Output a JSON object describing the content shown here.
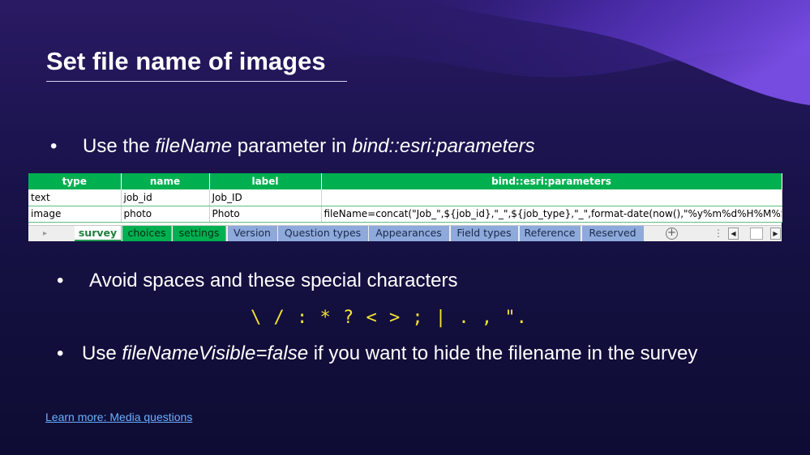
{
  "slide": {
    "title": "Set file name of images",
    "bullet_glyph": "•",
    "bullet1": {
      "pre": "Use the ",
      "em1": "fileName",
      "mid": " parameter in ",
      "em2": "bind::esri:parameters"
    },
    "bullet2": " Avoid spaces and these special characters",
    "special_chars": "\\ / : * ? < > ; | . , \".",
    "bullet3": {
      "pre": "Use ",
      "em": "fileNameVisible=false",
      "post": " if you want to hide the filename in the survey"
    },
    "learn_more": "Learn more: Media questions"
  },
  "sheet": {
    "headers": [
      "type",
      "name",
      "label",
      "bind::esri:parameters"
    ],
    "rows": [
      [
        "text",
        "job_id",
        "Job_ID",
        ""
      ],
      [
        "image",
        "photo",
        "Photo",
        "fileName=concat(\"Job_\",${job_id},\"_\",${job_type},\"_\",format-date(now(),\"%y%m%d%H%M%S\"))"
      ]
    ],
    "tabs": [
      "survey",
      "choices",
      "settings",
      "Version",
      "Question types",
      "Appearances",
      "Field types",
      "Reference",
      "Reserved"
    ],
    "active_tab": "survey",
    "add_sheet": "+",
    "overflow": "⋮",
    "scroll_left": "◀",
    "scroll_right": "▶",
    "nav_arrow": "▸"
  },
  "colors": {
    "header_green": "#00b050",
    "tab_blue": "#8ea9db",
    "special_chars": "#f3e234",
    "link": "#6ab0ff"
  }
}
